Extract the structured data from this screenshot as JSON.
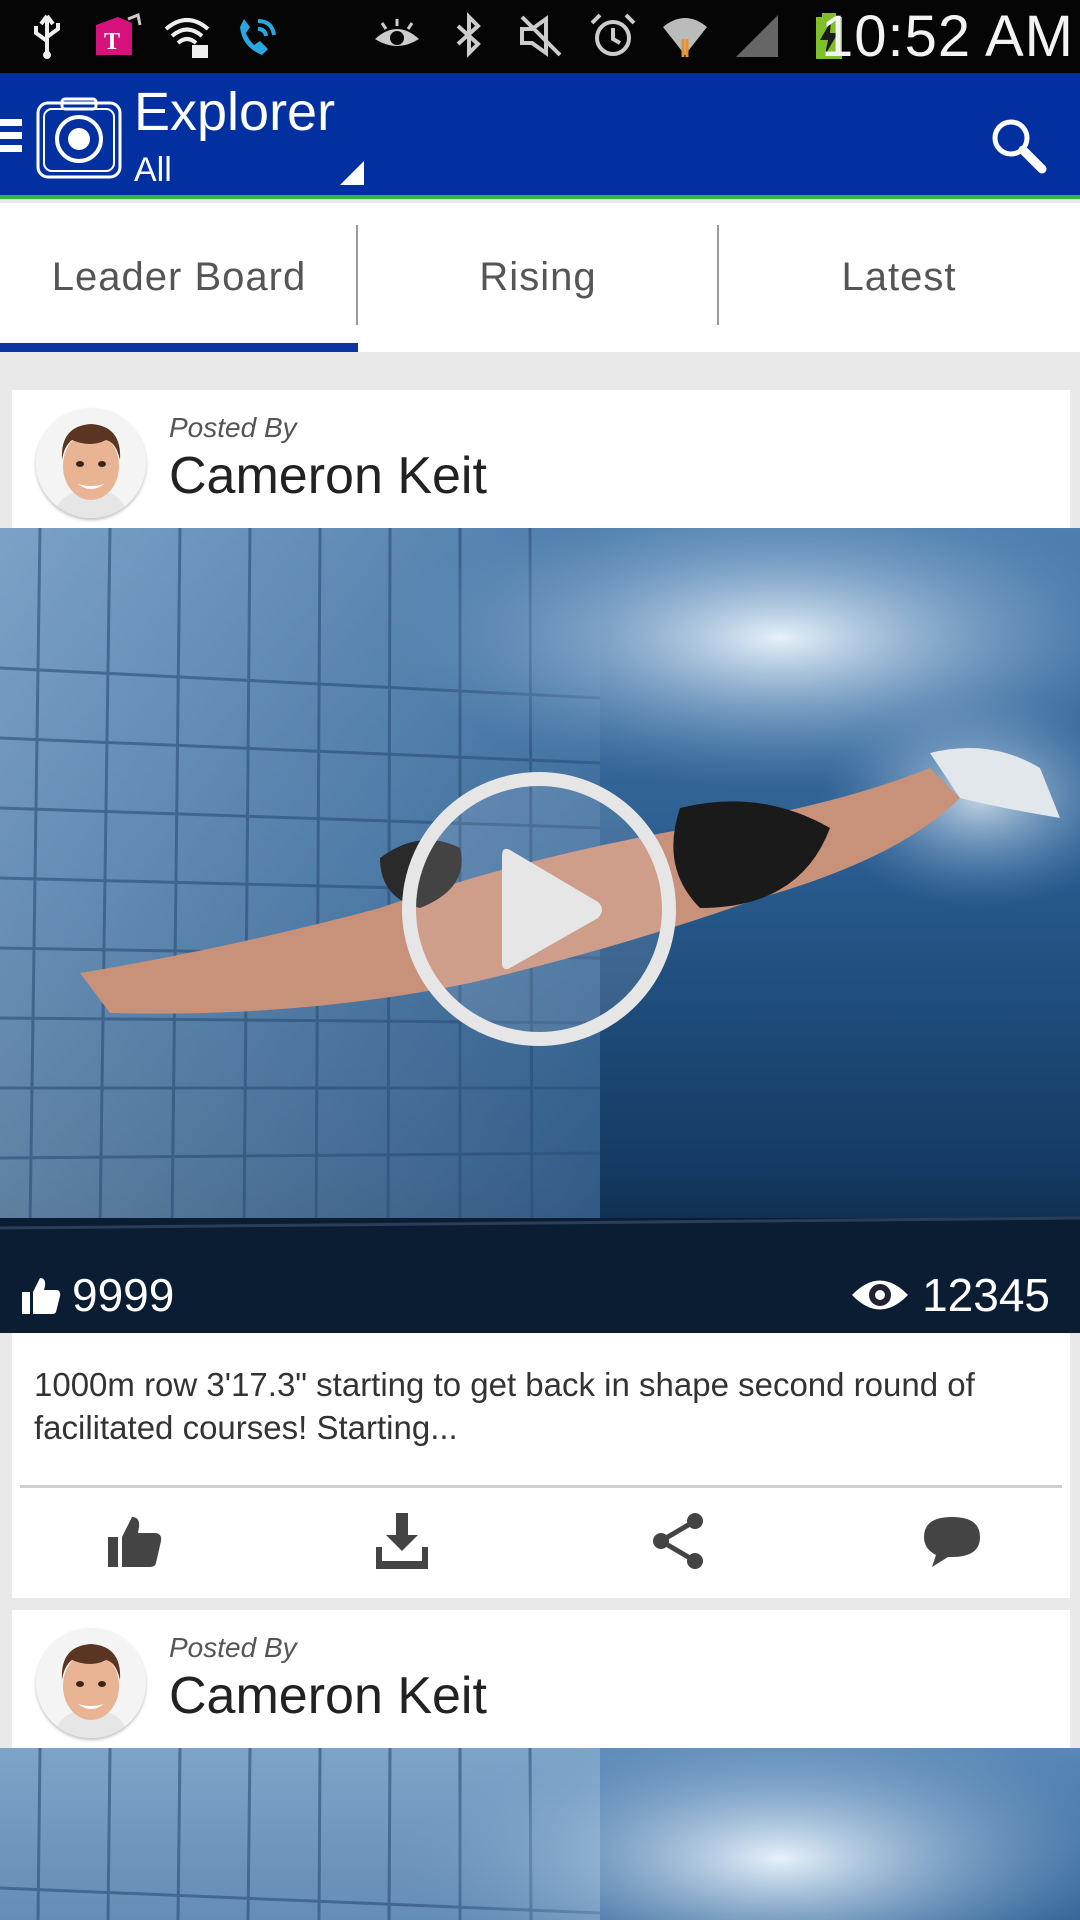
{
  "status_bar": {
    "time": "10:52 AM",
    "left_icons": [
      "usb-icon",
      "t-mobile-icon",
      "wifi-lock-icon",
      "wifi-calling-icon"
    ],
    "right_icons": [
      "eye-icon",
      "bluetooth-icon",
      "mute-icon",
      "alarm-icon",
      "wifi-icon",
      "signal-icon",
      "battery-charging-icon"
    ]
  },
  "app_bar": {
    "title": "Explorer",
    "filter": "All",
    "accent": "#0330a0",
    "underline": "#35b44a"
  },
  "tabs": [
    {
      "label": "Leader Board",
      "selected": true
    },
    {
      "label": "Rising",
      "selected": false
    },
    {
      "label": "Latest",
      "selected": false
    }
  ],
  "posts": [
    {
      "posted_by_label": "Posted By",
      "author": "Cameron Keit",
      "likes": "9999",
      "views": "12345",
      "caption": "1000m row 3'17.3\" starting to get back in shape second round of facilitated courses! Starting...",
      "actions": [
        "like-icon",
        "download-icon",
        "share-icon",
        "comment-icon"
      ]
    },
    {
      "posted_by_label": "Posted By",
      "author": "Cameron Keit"
    }
  ]
}
